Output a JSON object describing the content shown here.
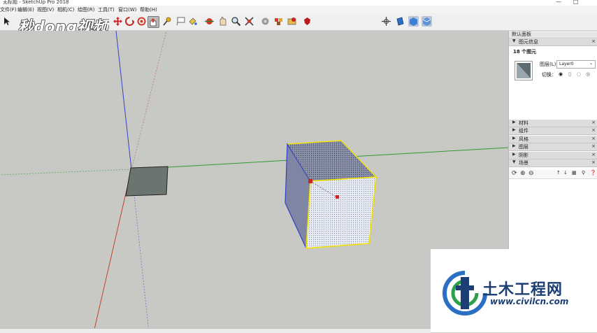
{
  "window": {
    "title": "无标题 - SketchUp Pro 2018",
    "controls": [
      "—",
      "□"
    ]
  },
  "menu": [
    {
      "label": "文件(F)"
    },
    {
      "label": "编辑(E)"
    },
    {
      "label": "视图(V)"
    },
    {
      "label": "相机(C)"
    },
    {
      "label": "绘图(R)"
    },
    {
      "label": "工具(T)"
    },
    {
      "label": "窗口(W)"
    },
    {
      "label": "帮助(H)"
    }
  ],
  "toolbar": {
    "tools": [
      "select-arrow-icon",
      "eraser-icon",
      "paint-icon",
      "line-icon",
      "arc-icon",
      "rectangle-icon",
      "push-pull-icon",
      "move-icon",
      "rotate-icon",
      "scale-icon",
      "tape-icon",
      "text-icon",
      "paint-bucket-icon",
      "orbit-icon",
      "pan-icon",
      "zoom-icon",
      "zoom-extents-icon",
      "warehouse-icon",
      "extension-icon",
      "ruby-icon"
    ],
    "right_tools": [
      "axes-icon",
      "section-plane-icon",
      "section-display-icon",
      "section-cut-icon"
    ]
  },
  "watermark_top": {
    "text": "秒dong视频"
  },
  "tray": {
    "title": "默认面板",
    "entity_info": {
      "header": "图元信息",
      "count": "18 个图元",
      "layer_label": "图层(L):",
      "layer_value": "Layer0",
      "toggle_label": "切换："
    },
    "panels": [
      {
        "label": "材料"
      },
      {
        "label": "组件"
      },
      {
        "label": "风格"
      },
      {
        "label": "图层"
      },
      {
        "label": "阴影"
      },
      {
        "label": "场景"
      }
    ]
  },
  "watermark_bottom": {
    "title": "土木工程网",
    "url": "www.civilcn.com"
  },
  "colors": {
    "viewport_bg": "#c8c9c5",
    "axis_red": "#c0422c",
    "axis_green": "#2f9a2f",
    "axis_blue": "#3340c8",
    "selection_yellow": "#f2e200",
    "brand_blue": "#1b3f74"
  }
}
